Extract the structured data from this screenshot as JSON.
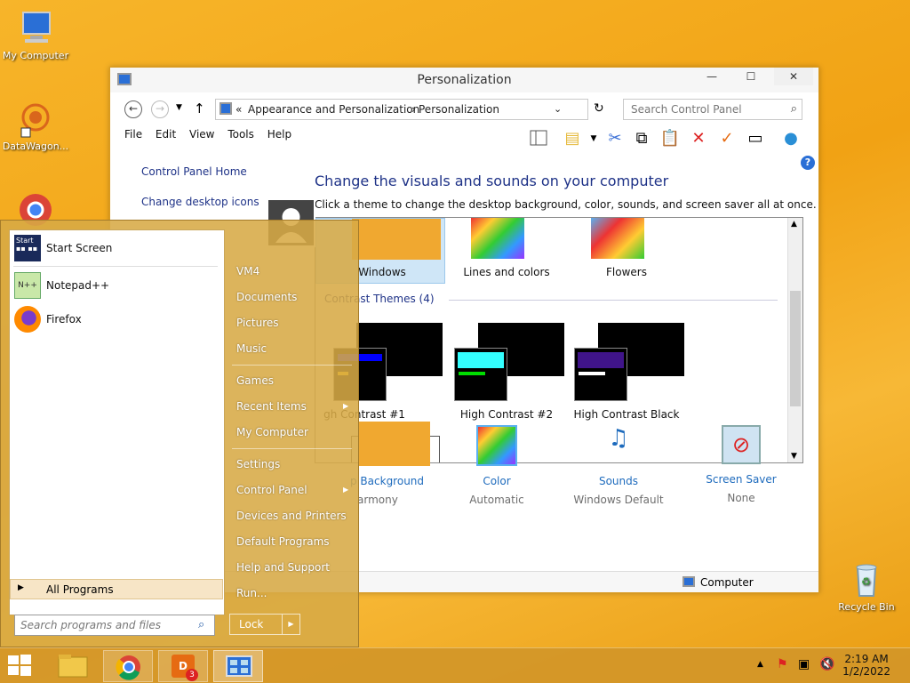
{
  "desktop": {
    "icons": [
      {
        "label": "My Computer"
      },
      {
        "label": "DataWagon..."
      },
      {
        "label": "Recycle Bin"
      }
    ]
  },
  "window": {
    "title": "Personalization",
    "address": {
      "prefix": "«",
      "crumb1": "Appearance and Personalization",
      "sep": "›",
      "crumb2": "Personalization"
    },
    "search_placeholder": "Search Control Panel",
    "menu": [
      "File",
      "Edit",
      "View",
      "Tools",
      "Help"
    ],
    "sidebar": [
      "Control Panel Home",
      "Change desktop icons"
    ],
    "heading": "Change the visuals and sounds on your computer",
    "subheading": "Click a theme to change the desktop background, color, sounds, and screen saver all at once.",
    "themes": {
      "top_row": [
        "Windows",
        "Lines and colors",
        "Flowers"
      ],
      "group_label": "Contrast Themes (4)",
      "hc_row": [
        "gh Contrast #1",
        "High Contrast #2",
        "High Contrast Black"
      ]
    },
    "bottom": [
      {
        "label": "p Background",
        "sub": "armony"
      },
      {
        "label": "Color",
        "sub": "Automatic"
      },
      {
        "label": "Sounds",
        "sub": "Windows Default"
      },
      {
        "label": "Screen Saver",
        "sub": "None"
      }
    ],
    "status": "Computer"
  },
  "start_menu": {
    "pinned": [
      "Start Screen",
      "Notepad++",
      "Firefox"
    ],
    "all_programs": "All Programs",
    "search_placeholder": "Search programs and files",
    "right": [
      "VM4",
      "Documents",
      "Pictures",
      "Music",
      "Games",
      "Recent Items",
      "My Computer",
      "Settings",
      "Control Panel",
      "Devices and Printers",
      "Default Programs",
      "Help and Support",
      "Run..."
    ],
    "lock": "Lock"
  },
  "taskbar": {
    "time": "2:19 AM",
    "date": "1/2/2022",
    "badge": "3"
  },
  "colors": {
    "link": "#1e3287",
    "accent_blue": "#1e6bbd",
    "desktop": "#f1a214"
  }
}
